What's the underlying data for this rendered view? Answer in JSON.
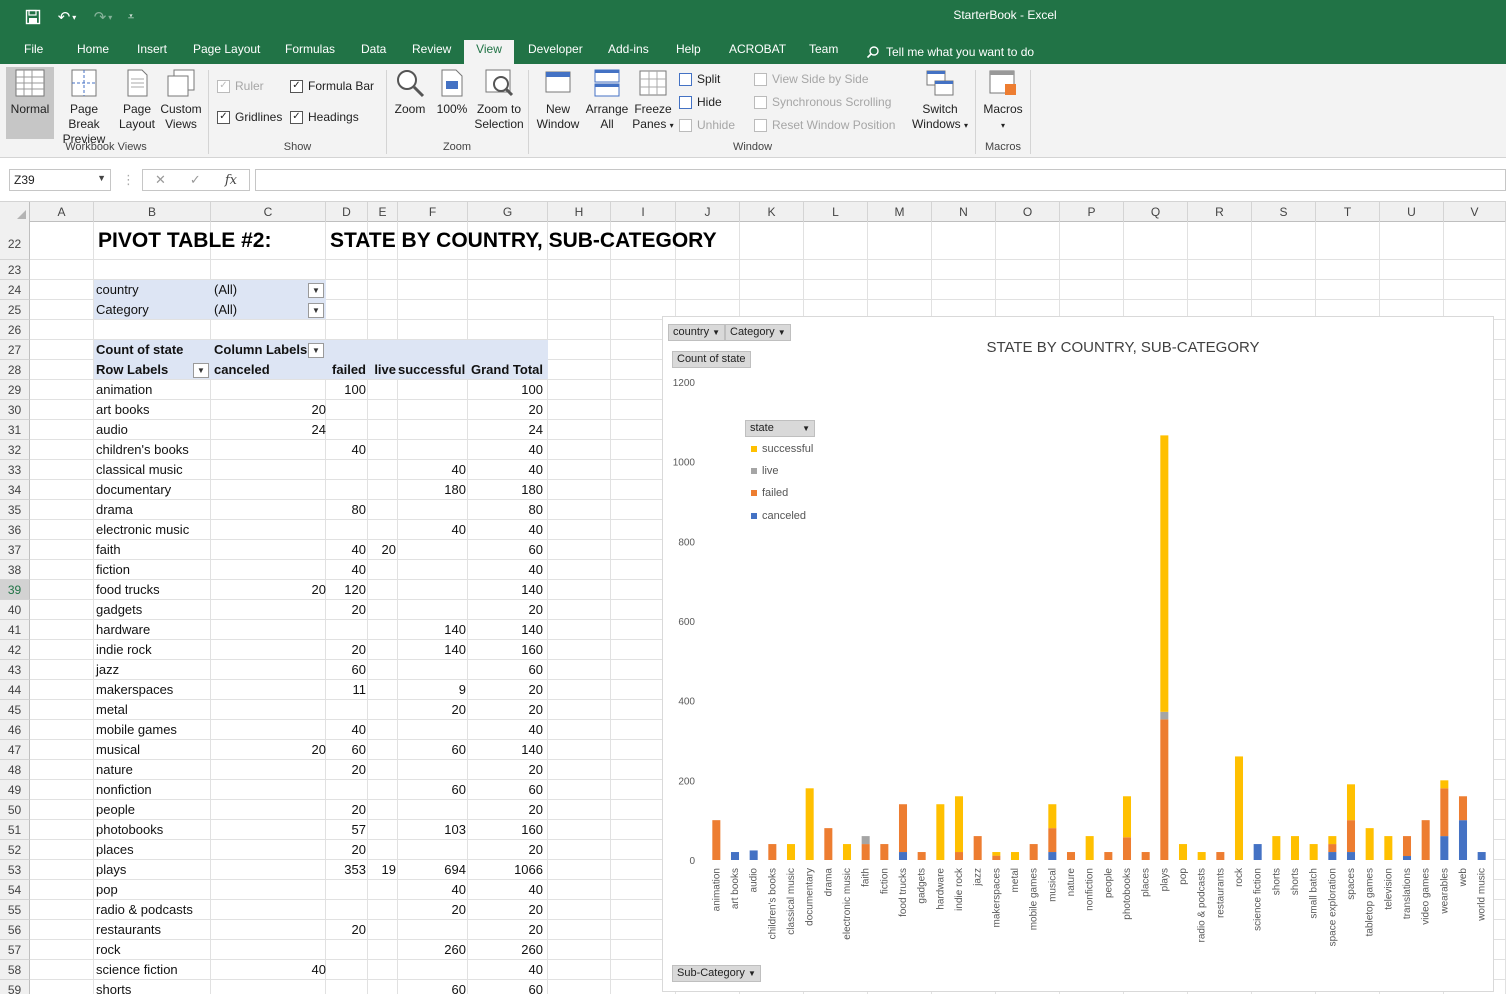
{
  "window": {
    "title": "StarterBook  -  Excel"
  },
  "tabs": [
    "File",
    "Home",
    "Insert",
    "Page Layout",
    "Formulas",
    "Data",
    "Review",
    "View",
    "Developer",
    "Add-ins",
    "Help",
    "ACROBAT",
    "Team"
  ],
  "active_tab": "View",
  "tell_me": "Tell me what you want to do",
  "ribbon": {
    "workbook_views": {
      "label": "Workbook Views",
      "normal": "Normal",
      "page_break_1": "Page Break",
      "page_break_2": "Preview",
      "page_layout_1": "Page",
      "page_layout_2": "Layout",
      "custom_1": "Custom",
      "custom_2": "Views"
    },
    "show": {
      "label": "Show",
      "ruler": "Ruler",
      "formula_bar": "Formula Bar",
      "gridlines": "Gridlines",
      "headings": "Headings"
    },
    "zoom": {
      "label": "Zoom",
      "zoom": "Zoom",
      "hundred": "100%",
      "zoom_sel_1": "Zoom to",
      "zoom_sel_2": "Selection"
    },
    "window": {
      "label": "Window",
      "new_1": "New",
      "new_2": "Window",
      "arrange_1": "Arrange",
      "arrange_2": "All",
      "freeze_1": "Freeze",
      "freeze_2": "Panes",
      "split": "Split",
      "hide": "Hide",
      "unhide": "Unhide",
      "side_by_side": "View Side by Side",
      "sync_scroll": "Synchronous Scrolling",
      "reset_pos": "Reset Window Position",
      "switch_1": "Switch",
      "switch_2": "Windows"
    },
    "macros": {
      "label": "Macros",
      "macros": "Macros"
    }
  },
  "formula_bar": {
    "name_box": "Z39",
    "content": ""
  },
  "columns": [
    "A",
    "B",
    "C",
    "D",
    "E",
    "F",
    "G",
    "H",
    "I",
    "J",
    "K",
    "L",
    "M",
    "N",
    "O",
    "P",
    "Q",
    "R",
    "S",
    "T",
    "U",
    "V"
  ],
  "rows": [
    22,
    23,
    24,
    25,
    26,
    27,
    28,
    29,
    30,
    31,
    32,
    33,
    34,
    35,
    36,
    37,
    38,
    39,
    40,
    41,
    42,
    43,
    44,
    45,
    46,
    47,
    48,
    49,
    50,
    51,
    52,
    53,
    54,
    55,
    56,
    57,
    58,
    59
  ],
  "selected_row": 39,
  "sheet": {
    "title_left": "PIVOT TABLE #2:",
    "title_right": "STATE BY COUNTRY, SUB-CATEGORY",
    "filters": [
      {
        "field": "country",
        "value": "(All)"
      },
      {
        "field": "Category",
        "value": "(All)"
      }
    ],
    "header1": {
      "count": "Count of state",
      "column_labels": "Column Labels"
    },
    "header2": {
      "row_labels": "Row Labels",
      "canceled": "canceled",
      "failed": "failed",
      "live": "live",
      "successful": "successful",
      "grand_total": "Grand Total"
    },
    "pivot_rows": [
      [
        "animation",
        "",
        "100",
        "",
        "",
        "100"
      ],
      [
        "art books",
        "20",
        "",
        "",
        "",
        "20"
      ],
      [
        "audio",
        "24",
        "",
        "",
        "",
        "24"
      ],
      [
        "children's books",
        "",
        "40",
        "",
        "",
        "40"
      ],
      [
        "classical music",
        "",
        "",
        "",
        "40",
        "40"
      ],
      [
        "documentary",
        "",
        "",
        "",
        "180",
        "180"
      ],
      [
        "drama",
        "",
        "80",
        "",
        "",
        "80"
      ],
      [
        "electronic music",
        "",
        "",
        "",
        "40",
        "40"
      ],
      [
        "faith",
        "",
        "40",
        "20",
        "",
        "60"
      ],
      [
        "fiction",
        "",
        "40",
        "",
        "",
        "40"
      ],
      [
        "food trucks",
        "20",
        "120",
        "",
        "",
        "140"
      ],
      [
        "gadgets",
        "",
        "20",
        "",
        "",
        "20"
      ],
      [
        "hardware",
        "",
        "",
        "",
        "140",
        "140"
      ],
      [
        "indie rock",
        "",
        "20",
        "",
        "140",
        "160"
      ],
      [
        "jazz",
        "",
        "60",
        "",
        "",
        "60"
      ],
      [
        "makerspaces",
        "",
        "11",
        "",
        "9",
        "20"
      ],
      [
        "metal",
        "",
        "",
        "",
        "20",
        "20"
      ],
      [
        "mobile games",
        "",
        "40",
        "",
        "",
        "40"
      ],
      [
        "musical",
        "20",
        "60",
        "",
        "60",
        "140"
      ],
      [
        "nature",
        "",
        "20",
        "",
        "",
        "20"
      ],
      [
        "nonfiction",
        "",
        "",
        "",
        "60",
        "60"
      ],
      [
        "people",
        "",
        "20",
        "",
        "",
        "20"
      ],
      [
        "photobooks",
        "",
        "57",
        "",
        "103",
        "160"
      ],
      [
        "places",
        "",
        "20",
        "",
        "",
        "20"
      ],
      [
        "plays",
        "",
        "353",
        "19",
        "694",
        "1066"
      ],
      [
        "pop",
        "",
        "",
        "",
        "40",
        "40"
      ],
      [
        "radio & podcasts",
        "",
        "",
        "",
        "20",
        "20"
      ],
      [
        "restaurants",
        "",
        "20",
        "",
        "",
        "20"
      ],
      [
        "rock",
        "",
        "",
        "",
        "260",
        "260"
      ],
      [
        "science fiction",
        "40",
        "",
        "",
        "",
        "40"
      ],
      [
        "shorts",
        "",
        "",
        "",
        "60",
        "60"
      ]
    ]
  },
  "chart": {
    "filter_buttons": [
      "country",
      "Category"
    ],
    "value_button": "Count of state",
    "axis_button": "Sub-Category",
    "legend_button": "state",
    "colors": {
      "canceled": "#4472c4",
      "failed": "#ed7d31",
      "live": "#a5a5a5",
      "successful": "#ffc000"
    }
  },
  "chart_data": {
    "type": "bar",
    "stacked": true,
    "title": "STATE BY COUNTRY, SUB-CATEGORY",
    "ylim": [
      0,
      1200
    ],
    "yticks": [
      0,
      200,
      400,
      600,
      800,
      1000,
      1200
    ],
    "legend_position": "top-left",
    "categories": [
      "animation",
      "art books",
      "audio",
      "children's books",
      "classical music",
      "documentary",
      "drama",
      "electronic music",
      "faith",
      "fiction",
      "food trucks",
      "gadgets",
      "hardware",
      "indie rock",
      "jazz",
      "makerspaces",
      "metal",
      "mobile games",
      "musical",
      "nature",
      "nonfiction",
      "people",
      "photobooks",
      "places",
      "plays",
      "pop",
      "radio & podcasts",
      "restaurants",
      "rock",
      "science fiction",
      "shorts",
      "shorts",
      "small batch",
      "space exploration",
      "spaces",
      "tabletop games",
      "television",
      "translations",
      "video games",
      "wearables",
      "web",
      "world music"
    ],
    "series": [
      {
        "name": "canceled",
        "values": [
          0,
          20,
          24,
          0,
          0,
          0,
          0,
          0,
          0,
          0,
          20,
          0,
          0,
          0,
          0,
          0,
          0,
          0,
          20,
          0,
          0,
          0,
          0,
          0,
          0,
          0,
          0,
          0,
          0,
          40,
          0,
          0,
          0,
          20,
          20,
          0,
          0,
          10,
          0,
          60,
          100,
          20
        ]
      },
      {
        "name": "failed",
        "values": [
          100,
          0,
          0,
          40,
          0,
          0,
          80,
          0,
          40,
          40,
          120,
          20,
          0,
          20,
          60,
          11,
          0,
          40,
          60,
          20,
          0,
          20,
          57,
          20,
          353,
          0,
          0,
          20,
          0,
          0,
          0,
          0,
          0,
          20,
          80,
          0,
          0,
          50,
          100,
          120,
          60,
          0
        ]
      },
      {
        "name": "live",
        "values": [
          0,
          0,
          0,
          0,
          0,
          0,
          0,
          0,
          20,
          0,
          0,
          0,
          0,
          0,
          0,
          0,
          0,
          0,
          0,
          0,
          0,
          0,
          0,
          0,
          19,
          0,
          0,
          0,
          0,
          0,
          0,
          0,
          0,
          0,
          0,
          0,
          0,
          0,
          0,
          0,
          0,
          0
        ]
      },
      {
        "name": "successful",
        "values": [
          0,
          0,
          0,
          0,
          40,
          180,
          0,
          40,
          0,
          0,
          0,
          0,
          140,
          140,
          0,
          9,
          20,
          0,
          60,
          0,
          60,
          0,
          103,
          0,
          694,
          40,
          20,
          0,
          260,
          0,
          60,
          60,
          40,
          20,
          90,
          80,
          60,
          0,
          0,
          20,
          0,
          0
        ]
      }
    ],
    "legend_order": [
      "successful",
      "live",
      "failed",
      "canceled"
    ]
  }
}
